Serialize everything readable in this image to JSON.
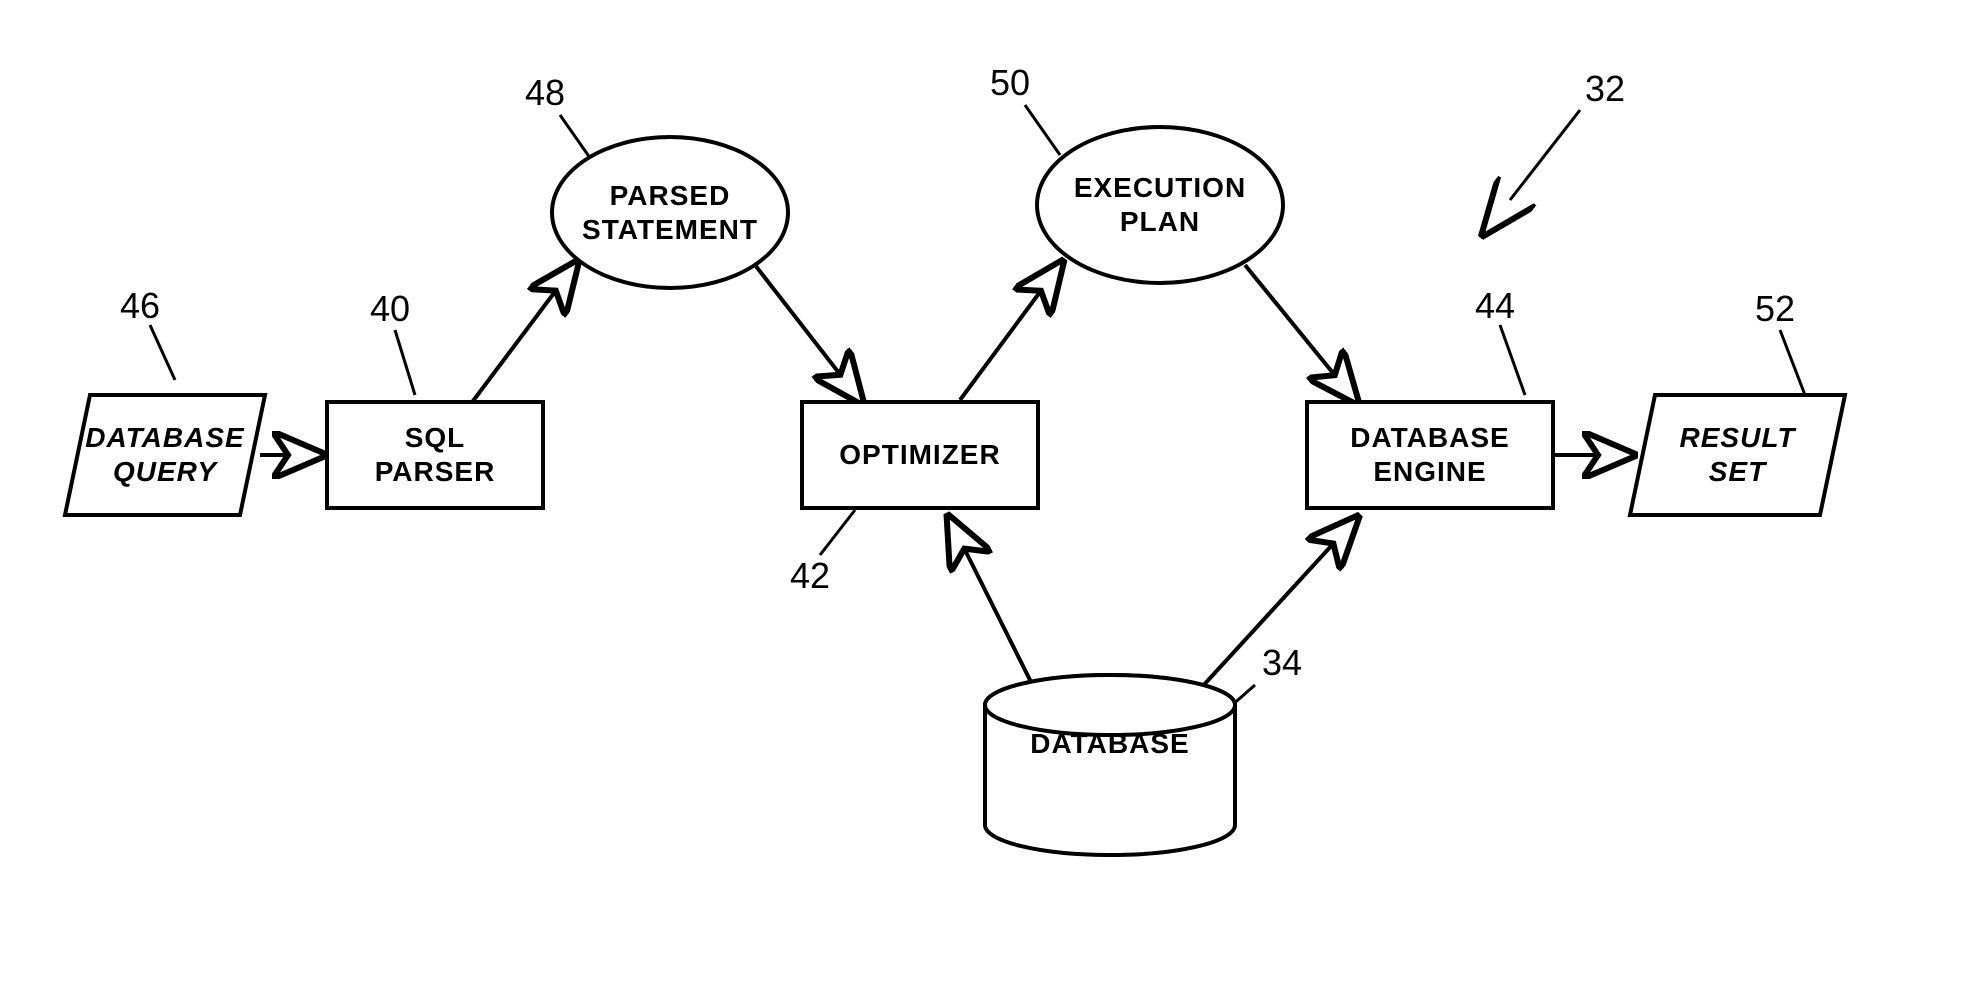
{
  "nodes": {
    "database_query": {
      "label": "DATABASE\nQUERY",
      "ref": "46"
    },
    "sql_parser": {
      "label": "SQL\nPARSER",
      "ref": "40"
    },
    "parsed_statement": {
      "label": "PARSED\nSTATEMENT",
      "ref": "48"
    },
    "optimizer": {
      "label": "OPTIMIZER",
      "ref": "42"
    },
    "execution_plan": {
      "label": "EXECUTION\nPLAN",
      "ref": "50"
    },
    "database_engine": {
      "label": "DATABASE\nENGINE",
      "ref": "44"
    },
    "result_set": {
      "label": "RESULT\nSET",
      "ref": "52"
    },
    "database": {
      "label": "DATABASE",
      "ref": "34"
    }
  },
  "system_ref": "32"
}
